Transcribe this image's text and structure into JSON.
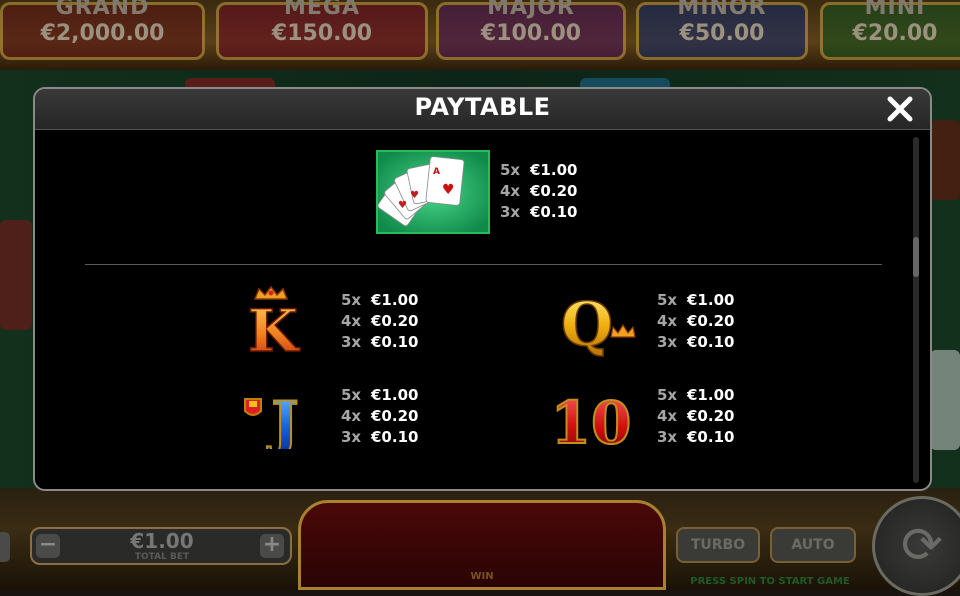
{
  "jackpots": [
    {
      "name": "GRAND",
      "value": "€2,000.00",
      "color": "#8a1a1a"
    },
    {
      "name": "MEGA",
      "value": "€150.00",
      "color": "#9a1030"
    },
    {
      "name": "MAJOR",
      "value": "€100.00",
      "color": "#6a1a7a"
    },
    {
      "name": "MINOR",
      "value": "€50.00",
      "color": "#1a3a8a"
    },
    {
      "name": "MINI",
      "value": "€20.00",
      "color": "#1a6a2a"
    }
  ],
  "bottom": {
    "minus_label": "−",
    "plus_label": "+",
    "total_bet_value": "€1.00",
    "total_bet_label": "TOTAL BET",
    "win_label": "WIN",
    "turbo_label": "TURBO",
    "auto_label": "AUTO",
    "status_text": "PRESS SPIN TO START GAME"
  },
  "paytable": {
    "title": "PAYTABLE",
    "close_icon": "close-icon",
    "entries": [
      {
        "symbol": "royal-flush-cards",
        "pays": [
          {
            "count": "5x",
            "value": "€1.00"
          },
          {
            "count": "4x",
            "value": "€0.20"
          },
          {
            "count": "3x",
            "value": "€0.10"
          }
        ]
      },
      {
        "symbol": "king-k",
        "pays": [
          {
            "count": "5x",
            "value": "€1.00"
          },
          {
            "count": "4x",
            "value": "€0.20"
          },
          {
            "count": "3x",
            "value": "€0.10"
          }
        ]
      },
      {
        "symbol": "queen-q",
        "pays": [
          {
            "count": "5x",
            "value": "€1.00"
          },
          {
            "count": "4x",
            "value": "€0.20"
          },
          {
            "count": "3x",
            "value": "€0.10"
          }
        ]
      },
      {
        "symbol": "jack-j",
        "pays": [
          {
            "count": "5x",
            "value": "€1.00"
          },
          {
            "count": "4x",
            "value": "€0.20"
          },
          {
            "count": "3x",
            "value": "€0.10"
          }
        ]
      },
      {
        "symbol": "ten-10",
        "pays": [
          {
            "count": "5x",
            "value": "€1.00"
          },
          {
            "count": "4x",
            "value": "€0.20"
          },
          {
            "count": "3x",
            "value": "€0.10"
          }
        ]
      }
    ]
  }
}
